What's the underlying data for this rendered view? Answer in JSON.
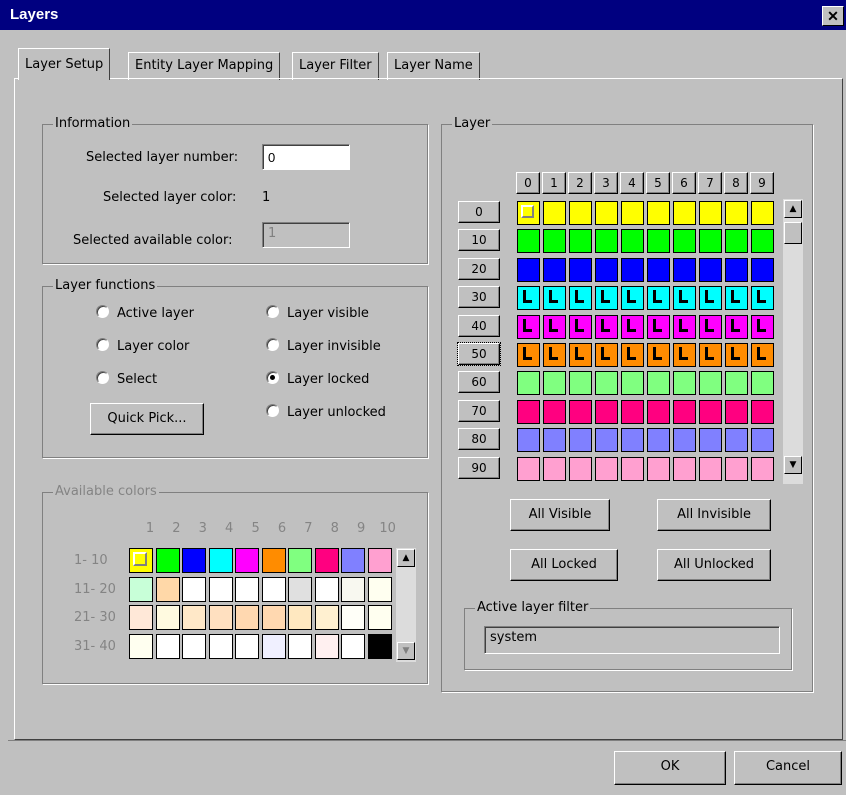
{
  "window": {
    "title": "Layers",
    "close_glyph": "✕"
  },
  "tabs": [
    {
      "label": "Layer Setup",
      "active": true
    },
    {
      "label": "Entity Layer Mapping",
      "active": false
    },
    {
      "label": "Layer Filter",
      "active": false
    },
    {
      "label": "Layer Name",
      "active": false
    }
  ],
  "information": {
    "title": "Information",
    "selected_layer_number_label": "Selected layer number:",
    "selected_layer_number_value": "0",
    "selected_layer_color_label": "Selected layer color:",
    "selected_layer_color_value": "1",
    "selected_available_color_label": "Selected available color:",
    "selected_available_color_value": "1"
  },
  "layer_functions": {
    "title": "Layer functions",
    "options": [
      {
        "label": "Active layer",
        "checked": false
      },
      {
        "label": "Layer color",
        "checked": false
      },
      {
        "label": "Select",
        "checked": false
      },
      {
        "label": "Layer visible",
        "checked": false
      },
      {
        "label": "Layer invisible",
        "checked": false
      },
      {
        "label": "Layer locked",
        "checked": true
      },
      {
        "label": "Layer unlocked",
        "checked": false
      }
    ],
    "quick_pick_label": "Quick Pick..."
  },
  "available_colors": {
    "title": "Available colors",
    "col_headers": [
      "1",
      "2",
      "3",
      "4",
      "5",
      "6",
      "7",
      "8",
      "9",
      "10"
    ],
    "row_labels": [
      "1- 10",
      "11- 20",
      "21- 30",
      "31- 40"
    ],
    "rows": [
      [
        "#ffff00",
        "#00ff00",
        "#0000ff",
        "#00ffff",
        "#ff00ff",
        "#ff8c00",
        "#80ff80",
        "#ff0080",
        "#8080ff",
        "#ffa0d0"
      ],
      [
        "#c8ffd8",
        "#ffd8a8",
        "#ffffff",
        "#ffffff",
        "#ffffff",
        "#ffffff",
        "#e0e0e0",
        "#ffffff",
        "#f8f8f0",
        "#fffff0"
      ],
      [
        "#ffe8d8",
        "#fffae0",
        "#ffe8c8",
        "#ffe0c0",
        "#ffd8b0",
        "#ffd8b0",
        "#ffe8c0",
        "#fff0d0",
        "#fffff8",
        "#fffff0"
      ],
      [
        "#fffff0",
        "#ffffff",
        "#ffffff",
        "#ffffff",
        "#ffffff",
        "#f0f0ff",
        "#ffffff",
        "#fff0f0",
        "#ffffff",
        "#000000"
      ]
    ]
  },
  "layer": {
    "title": "Layer",
    "col_headers": [
      "0",
      "1",
      "2",
      "3",
      "4",
      "5",
      "6",
      "7",
      "8",
      "9"
    ],
    "row_labels": [
      "0",
      "10",
      "20",
      "30",
      "40",
      "50",
      "60",
      "70",
      "80",
      "90"
    ],
    "row_colors": [
      "#ffff00",
      "#00ff00",
      "#0000ff",
      "#00ffff",
      "#ff00ff",
      "#ff8c00",
      "#80ff80",
      "#ff0080",
      "#8080ff",
      "#ffa0d0"
    ],
    "locked_rows": [
      3,
      4,
      5
    ],
    "selected_row_label_index": 5,
    "buttons": {
      "all_visible": "All Visible",
      "all_invisible": "All Invisible",
      "all_locked": "All Locked",
      "all_unlocked": "All Unlocked"
    },
    "active_filter_title": "Active layer filter",
    "active_filter_value": "system"
  },
  "footer": {
    "ok": "OK",
    "cancel": "Cancel"
  },
  "colors": {
    "titlebar": "#000080",
    "face": "#c0c0c0"
  }
}
